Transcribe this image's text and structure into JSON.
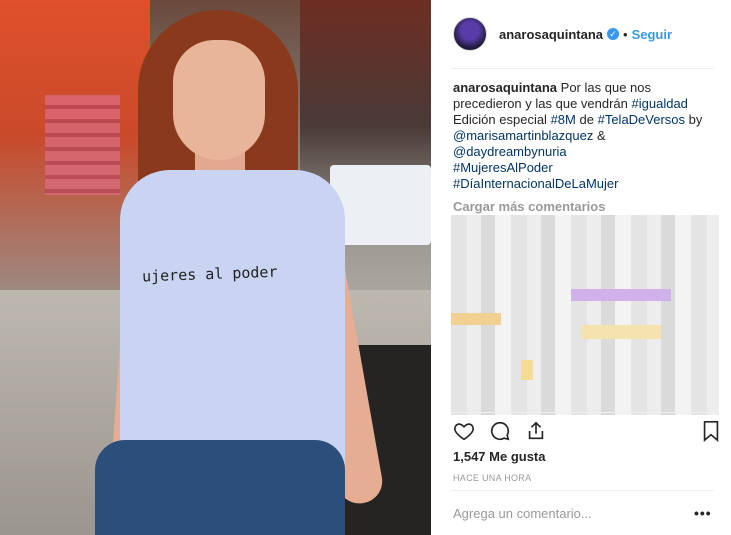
{
  "post": {
    "username": "anarosaquintana",
    "verified_icon": "verified-badge-icon",
    "separator": "•",
    "follow_label": "Seguir",
    "photo": {
      "shirt_text": "ujeres al poder"
    },
    "caption": {
      "username": "anarosaquintana",
      "text_1": "Por las que nos precedieron y las que vendrán",
      "tag_1": "#igualdad",
      "text_2": "Edición especial",
      "tag_2": "#8M",
      "text_3": "de",
      "tag_3": "#TelaDeVersos",
      "text_4": "by",
      "mention_1": "@marisamartinblazquez",
      "text_5": "&",
      "mention_2": "@daydreambynuria",
      "tag_4": "#MujeresAlPoder",
      "tag_5": "#DíaInternacionalDeLaMujer"
    },
    "load_more": "Cargar más comentarios",
    "likes": "1,547 Me gusta",
    "time": "HACE UNA HORA",
    "comment_placeholder": "Agrega un comentario...",
    "options": "•••"
  },
  "colors": {
    "accent": "#3897f0",
    "hashtag": "#003569",
    "muted": "#999999"
  }
}
